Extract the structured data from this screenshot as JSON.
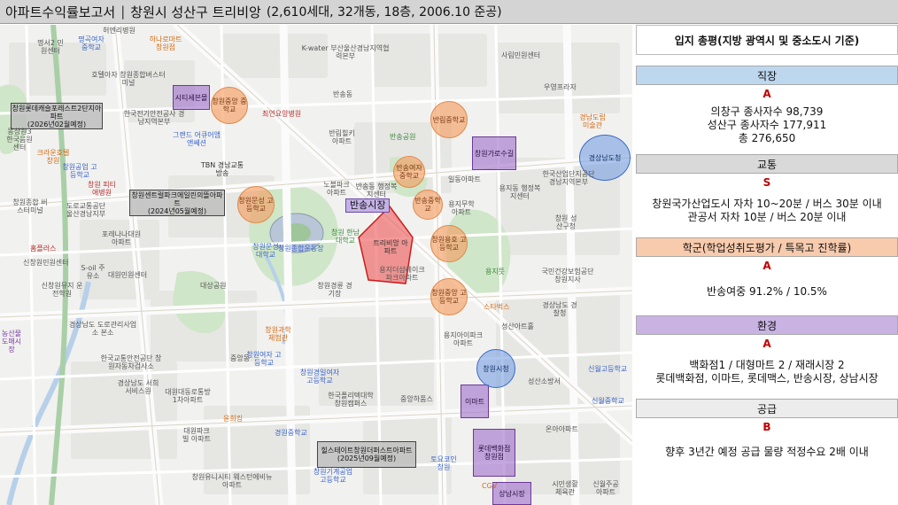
{
  "title": {
    "main": "아파트수익률보고서",
    "separator": "|",
    "complex": "창원시 성산구 트리비앙",
    "meta": "(2,610세대, 32개동, 18층, 2006.10 준공)"
  },
  "map": {
    "subject": "트리비앙 아파트",
    "market_tag": "반송시장",
    "gray_boxes": [
      {
        "line1": "창원롯데캐슬포레스트2단지아파트",
        "line2": "(2026년02월예정)"
      },
      {
        "line1": "창원센트럴파크에일린의뜰아파트",
        "line2": "(2024년05월예정)"
      },
      {
        "line1": "힐스테이트창원더퍼스트아파트",
        "line2": "(2025년09월예정)"
      }
    ],
    "purple_boxes": [
      {
        "label": "시티세븐몰"
      },
      {
        "label": "창원가로수길"
      },
      {
        "label": "이마트"
      },
      {
        "label": "롯데백화점 창원점"
      },
      {
        "label": "상남시장"
      }
    ],
    "orange_circles": [
      {
        "label": "창원중앙 중학교"
      },
      {
        "label": "반림중학교"
      },
      {
        "label": "창원문성 고등학교"
      },
      {
        "label": "반송여자 중학교"
      },
      {
        "label": "반송중학교"
      },
      {
        "label": "창원용호 고등학교"
      },
      {
        "label": "창원중앙 고등학교"
      }
    ],
    "blue_circles": [
      {
        "label": "경상남도청"
      },
      {
        "label": "창원시청"
      }
    ],
    "place_labels": [
      {
        "text": "허엔리병원"
      },
      {
        "text": "명서2 민원센터"
      },
      {
        "text": "명곡여자 중학교"
      },
      {
        "text": "하나로마트 창원점"
      },
      {
        "text": "K-water 부산울산경남지역협력본부"
      },
      {
        "text": "사림민원센터"
      },
      {
        "text": "우영프라자"
      },
      {
        "text": "호텔아자 창원종합버스터미널"
      },
      {
        "text": "반송동"
      },
      {
        "text": "한국전기안전공사 경남지역본부"
      },
      {
        "text": "최연요양병원"
      },
      {
        "text": "동창원3 한국음원센터"
      },
      {
        "text": "그랜드 어큐어앰앤쎄션"
      },
      {
        "text": "반림힐키 아파트"
      },
      {
        "text": "반송공원"
      },
      {
        "text": "경남도립 미술관"
      },
      {
        "text": "크라운호텔 창원"
      },
      {
        "text": "창원공업 고등학교"
      },
      {
        "text": "TBN 경남교통방송"
      },
      {
        "text": "노블파크 아파트"
      },
      {
        "text": "반송동 행정복지센터"
      },
      {
        "text": "일동아파트"
      },
      {
        "text": "용지동 행정복지센터"
      },
      {
        "text": "한국산업단지공단 경남지역본부"
      },
      {
        "text": "용지아이파크 아파트"
      },
      {
        "text": "창원종합 버스터미널"
      },
      {
        "text": "도로교통공단 울산경남지부"
      },
      {
        "text": "용지무학 아파트"
      },
      {
        "text": "창원 성산구청"
      },
      {
        "text": "포레나나대원 아파트"
      },
      {
        "text": "창원종합운동장"
      },
      {
        "text": "창원 한남대학교"
      },
      {
        "text": "용지더샵레이크 파크아파트"
      },
      {
        "text": "국민건강보험공단 창원지사"
      },
      {
        "text": "홈플러스"
      },
      {
        "text": "창원문성 대학교"
      },
      {
        "text": "신창원민원센터"
      },
      {
        "text": "대원민원센터"
      },
      {
        "text": "창원경륜 경기장"
      },
      {
        "text": "용지뜻"
      },
      {
        "text": "경상남도 경찰청"
      },
      {
        "text": "신창원뮤지 운전학원"
      },
      {
        "text": "대상공원"
      },
      {
        "text": "스타벅스"
      },
      {
        "text": "성산아트홀"
      },
      {
        "text": "경상남도 도로관리사업소 본소"
      },
      {
        "text": "창원과학 체험관"
      },
      {
        "text": "농산물 도매시장"
      },
      {
        "text": "중앙동"
      },
      {
        "text": "한국교통안전공단 창원자동차검사소"
      },
      {
        "text": "창원여자 고등학교"
      },
      {
        "text": "창원경일여자 고등학교"
      },
      {
        "text": "한국폴리텍대학 창원캠퍼스"
      },
      {
        "text": "신월고등학교"
      },
      {
        "text": "경상남도 서희서비스원"
      },
      {
        "text": "대원대동로통방 1차아파트"
      },
      {
        "text": "중앙하품스"
      },
      {
        "text": "성산소방서"
      },
      {
        "text": "신월중학교"
      },
      {
        "text": "대원파크빌 아파트"
      },
      {
        "text": "윤희킹"
      },
      {
        "text": "경원중학교"
      },
      {
        "text": "토요코인 창원"
      },
      {
        "text": "온아아파트"
      },
      {
        "text": "창원유니시티 웨스턴에비뉴아파트"
      },
      {
        "text": "창원기계공업 고등학교"
      },
      {
        "text": "CGV"
      },
      {
        "text": "시민생활 체육관"
      },
      {
        "text": "신월주공 아파트"
      },
      {
        "text": "S-oil 주유소"
      },
      {
        "text": "창원 피티애병원"
      }
    ]
  },
  "panel": {
    "title": "입지 총평(지방 광역시 및 중소도시 기준)",
    "sections": [
      {
        "head": "직장",
        "head_color": "#bdd7ee",
        "grade": "A",
        "lines": [
          "의창구 종사자수 98,739",
          "성산구 종사자수 177,911",
          "총 276,650"
        ]
      },
      {
        "head": "교통",
        "head_color": "#d9d9d9",
        "grade": "S",
        "lines": [
          "창원국가산업도시 자차 10~20분 / 버스 30분 이내",
          "관공서 자차 10분 / 버스 20분 이내"
        ]
      },
      {
        "head": "학군(학업성취도평가 / 특목고 진학률)",
        "head_color": "#f8cbad",
        "grade": "A",
        "lines": [
          "반송여중 91.2% / 10.5%"
        ]
      },
      {
        "head": "환경",
        "head_color": "#c9b3e3",
        "grade": "A",
        "lines": [
          "백화점1 / 대형마트 2 / 재래시장 2",
          "롯데백화점, 이마트, 롯데맥스, 반송시장, 상남시장"
        ]
      },
      {
        "head": "공급",
        "head_color": "#ececec",
        "grade": "B",
        "lines": [
          "향후 3년간 예정 공급 물량 적정수요 2배 이내"
        ]
      }
    ]
  }
}
